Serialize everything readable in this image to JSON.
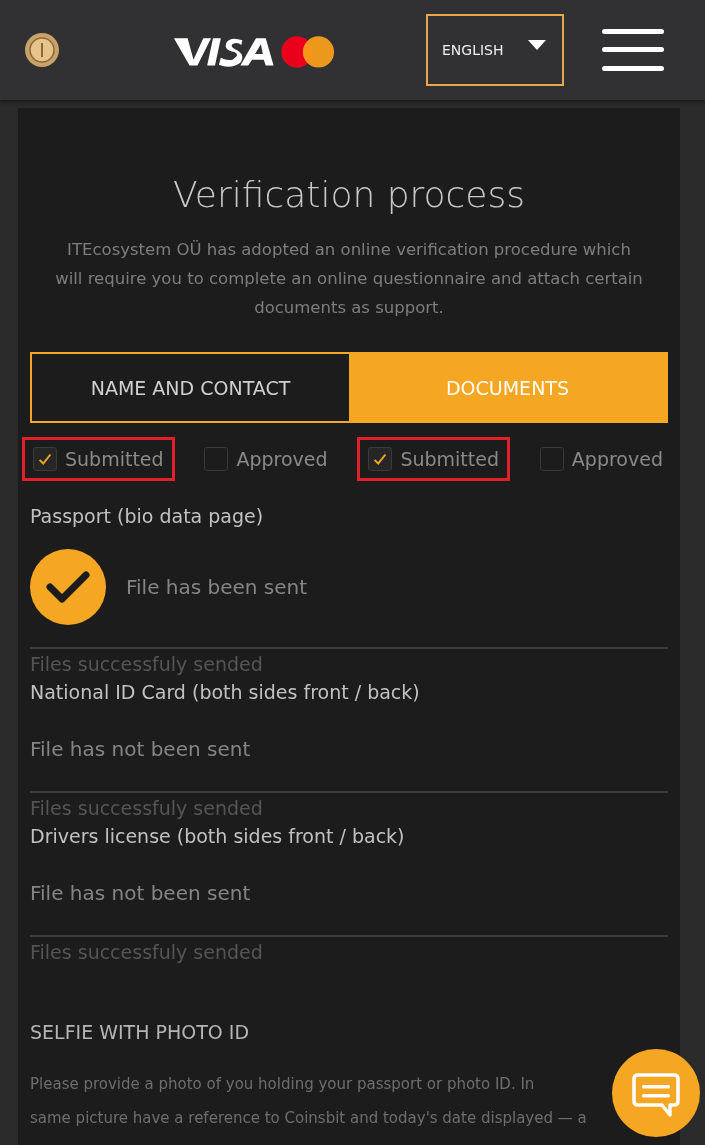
{
  "header": {
    "language": "ENGLISH"
  },
  "title": "Verification process",
  "intro": "ITEcosystem OÜ has adopted an online verification procedure which will require you to complete an online questionnaire and attach certain documents as support.",
  "tabs": [
    {
      "label": "NAME AND CONTACT",
      "selected": false
    },
    {
      "label": "DOCUMENTS",
      "selected": true
    }
  ],
  "statuses": [
    {
      "label": "Submitted",
      "checked": true,
      "highlighted": true
    },
    {
      "label": "Approved",
      "checked": false,
      "highlighted": false
    },
    {
      "label": "Submitted",
      "checked": true,
      "highlighted": true
    },
    {
      "label": "Approved",
      "checked": false,
      "highlighted": false
    }
  ],
  "documents": [
    {
      "name": "Passport (bio data page)",
      "sent": true,
      "status": "File has been sent",
      "note": "Files successfuly sended"
    },
    {
      "name": "National ID Card (both sides front / back)",
      "sent": false,
      "status": "File has not been sent",
      "note": "Files successfuly sended"
    },
    {
      "name": "Drivers license (both sides front / back)",
      "sent": false,
      "status": "File has not been sent",
      "note": "Files successfuly sended"
    }
  ],
  "selfie": {
    "heading": "SELFIE WITH PHOTO ID",
    "lines": [
      "Please provide a photo of you holding your passport or photo ID. In",
      "same picture have a reference to Coinsbit and today's date displayed — a"
    ]
  }
}
